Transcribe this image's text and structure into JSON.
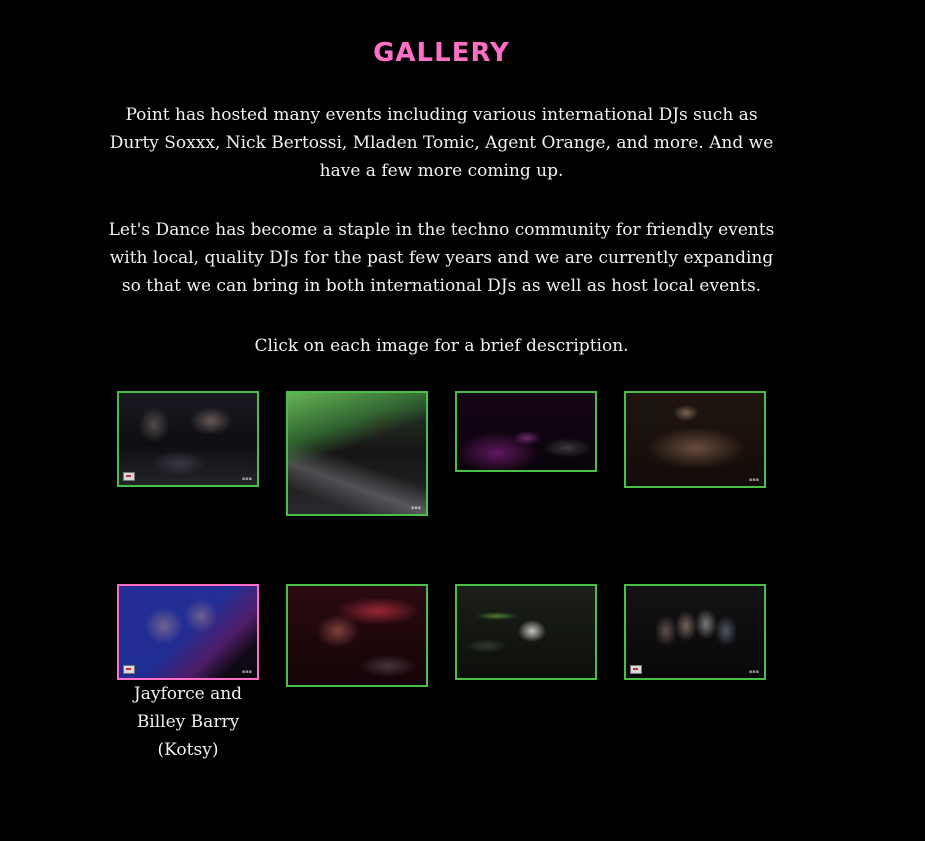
{
  "page": {
    "title": "GALLERY",
    "paragraphs": [
      "Point has hosted many events including various international DJs such as Durty Soxxx, Nick Bertossi, Mladen Tomic, Agent Orange, and more. And we have a few more coming up.",
      "Let's Dance has become a staple in the techno community for friendly events with local, quality DJs for the past few years and we are currently expanding so that we can bring in both international DJs as well as host local events.",
      "Click on each image for a brief description."
    ]
  },
  "colors": {
    "background": "#000000",
    "title": "#ff6fc7",
    "thumb_border": "#48c048",
    "thumb_border_active": "#ff6fc7",
    "text": "#f2f2f2"
  },
  "gallery": {
    "selected_index": 4,
    "selected_caption": "Jayforce and Billey Barry (Kotsy)"
  }
}
